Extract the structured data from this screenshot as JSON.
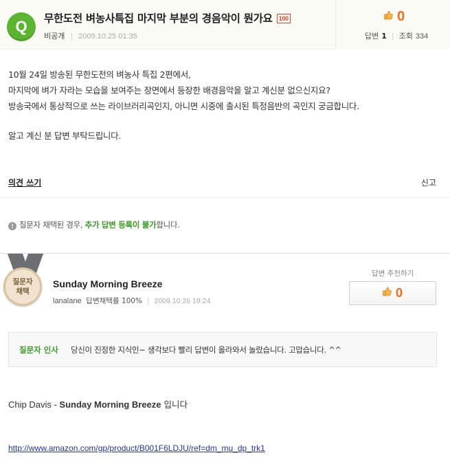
{
  "question": {
    "badge": "Q",
    "title": "무한도전 벼농사특집 마지막 부분의 경음악이 뭔가요",
    "points_badge": "100",
    "author": "비공개",
    "date": "2009.10.25 01:35",
    "recommend_count": "0",
    "answers_label": "답변",
    "answers_count": "1",
    "views_label": "조회",
    "views_count": "334",
    "body_lines": [
      "10월 24일 방송된 무한도전의 벼농사 특집 2편에서,",
      "마지막에 벼가 자라는 모습을 보여주는 장면에서 등장한 배경음악을 알고 계신분 없으신지요?",
      "방송국에서 통상적으로 쓰는 라이브러리곡인지, 아니면 시중에 출시된 특정음반의 곡인지 궁금합니다.",
      "알고 계신 분 답변 부탁드립니다."
    ],
    "opinion_link": "의견 쓰기",
    "report_link": "신고"
  },
  "notice": {
    "prefix": "질문자 채택된 경우,",
    "highlight": "추가 답변 등록이 불가",
    "suffix": "합니다."
  },
  "answer": {
    "medal_line1": "질문자",
    "medal_line2": "채택",
    "title": "Sunday Morning Breeze",
    "user": "lanalane",
    "adoption_rate": "답변채택률 100%",
    "date": "2009.10.26 19:24",
    "recommend_label": "답변 추천하기",
    "recommend_count": "0",
    "thanks_label": "질문자 인사",
    "thanks_message": "당신이 진정한 지식인~ 생각보다 빨리 답변이 올라와서 놀랐습니다. 고맙습니다. ^^",
    "artist": "Chip Davis - ",
    "song": "Sunday Morning Breeze",
    "suffix": " 입니다",
    "link": "http://www.amazon.com/gp/product/B001F6LDJU/ref=dm_mu_dp_trk1"
  },
  "colors": {
    "accent_green": "#5cb531",
    "recommend_orange": "#f26a1b",
    "link_blue": "#2233aa"
  },
  "icons": [
    "question-badge-icon",
    "thumbs-up-icon",
    "info-icon",
    "medal-icon"
  ]
}
